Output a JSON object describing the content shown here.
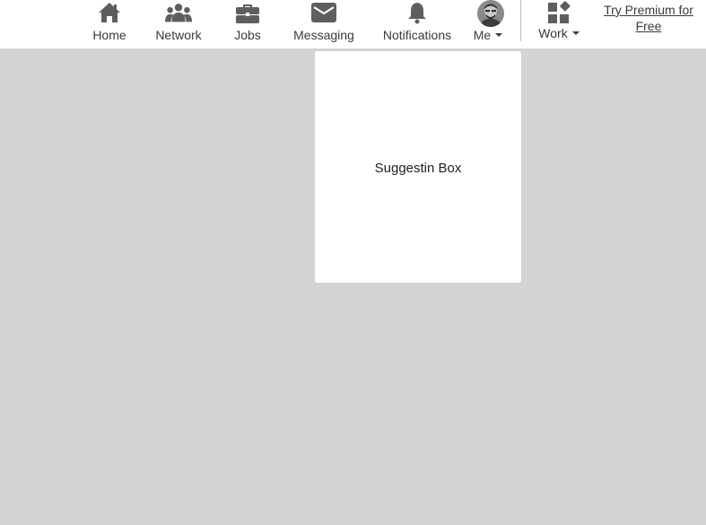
{
  "nav": {
    "home": {
      "label": "Home",
      "icon": "home-icon"
    },
    "network": {
      "label": "Network",
      "icon": "network-icon"
    },
    "jobs": {
      "label": "Jobs",
      "icon": "briefcase-icon"
    },
    "messaging": {
      "label": "Messaging",
      "icon": "envelope-icon"
    },
    "notifications": {
      "label": "Notifications",
      "icon": "bell-icon"
    },
    "me": {
      "label": "Me",
      "icon": "avatar"
    },
    "work": {
      "label": "Work",
      "icon": "apps-grid-icon"
    }
  },
  "premium": {
    "label": "Try Premium for Free"
  },
  "main": {
    "suggestion_box": {
      "label": "Suggestin Box"
    }
  },
  "colors": {
    "page_background": "#d4d4d4",
    "topbar_background": "#ffffff",
    "icon_color": "#5e5e5e",
    "text_color": "#3a3a3a"
  }
}
